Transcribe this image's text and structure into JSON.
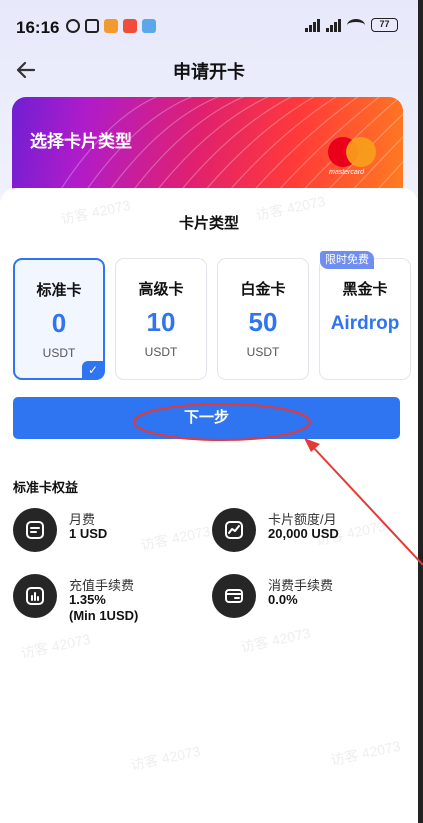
{
  "status_bar": {
    "time": "16:16",
    "battery": "77"
  },
  "header": {
    "title": "申请开卡"
  },
  "card": {
    "overlay_title": "选择卡片类型",
    "brand_text": "mastercard"
  },
  "section": {
    "title": "卡片类型"
  },
  "tiers": [
    {
      "name": "标准卡",
      "value": "0",
      "unit": "USDT",
      "selected": true
    },
    {
      "name": "高级卡",
      "value": "10",
      "unit": "USDT",
      "selected": false
    },
    {
      "name": "白金卡",
      "value": "50",
      "unit": "USDT",
      "selected": false
    },
    {
      "name": "黑金卡",
      "value": "Airdrop",
      "unit": "",
      "selected": false,
      "badge": "限时免费"
    }
  ],
  "next_button": {
    "label": "下一步"
  },
  "benefits": {
    "title": "标准卡权益",
    "items": [
      {
        "label": "月费",
        "value": "1 USD",
        "icon": "monthly-fee-icon"
      },
      {
        "label": "卡片额度/月",
        "value": "20,000 USD",
        "icon": "chart-line-icon"
      },
      {
        "label": "充值手续费",
        "value": "1.35%",
        "value2": "(Min 1USD)",
        "icon": "bar-chart-icon"
      },
      {
        "label": "消费手续费",
        "value": "0.0%",
        "icon": "wallet-icon"
      }
    ]
  },
  "watermark": {
    "text": "访客 42073"
  },
  "colors": {
    "accent": "#2f74f0",
    "badge": "#6f8ef0",
    "annotation": "#e53935"
  }
}
